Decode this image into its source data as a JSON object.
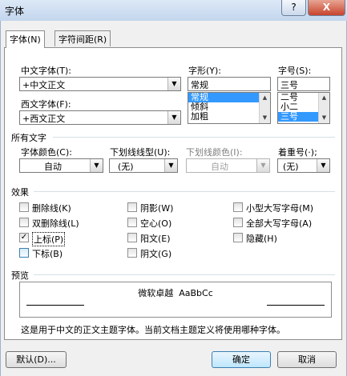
{
  "window": {
    "title": "字体",
    "help_label": "?",
    "close_label": "X"
  },
  "tabs": [
    {
      "label": "字体(N)"
    },
    {
      "label": "字符间距(R)"
    }
  ],
  "fonts": {
    "chinese_label": "中文字体(T):",
    "chinese_value": "+中文正文",
    "western_label": "西文字体(F):",
    "western_value": "+西文正文"
  },
  "style": {
    "label": "字形(Y):",
    "value": "常规",
    "options": [
      "常规",
      "倾斜",
      "加粗"
    ],
    "selected": "常规"
  },
  "size": {
    "label": "字号(S):",
    "value": "三号",
    "options": [
      "二号",
      "小二",
      "三号"
    ],
    "selected": "三号"
  },
  "all_text": {
    "heading": "所有文字",
    "font_color_label": "字体颜色(C):",
    "font_color_value": "自动",
    "underline_style_label": "下划线线型(U):",
    "underline_style_value": "(无)",
    "underline_color_label": "下划线颜色(I):",
    "underline_color_value": "自动",
    "emphasis_label": "着重号(·);",
    "emphasis_value": "(无)"
  },
  "effects": {
    "heading": "效果",
    "strikethrough": "删除线(K)",
    "double_strikethrough": "双删除线(L)",
    "superscript": "上标(P)",
    "subscript": "下标(B)",
    "shadow": "阴影(W)",
    "outline": "空心(O)",
    "emboss": "阳文(E)",
    "engrave": "阴文(G)",
    "small_caps": "小型大写字母(M)",
    "all_caps": "全部大写字母(A)",
    "hidden": "隐藏(H)"
  },
  "preview": {
    "heading": "预览",
    "sample": "微软卓越  AaBbCc",
    "description": "这是用于中文的正文主题字体。当前文档主题定义将使用哪种字体。"
  },
  "buttons": {
    "default_label": "默认(D)...",
    "ok_label": "确定",
    "cancel_label": "取消"
  }
}
